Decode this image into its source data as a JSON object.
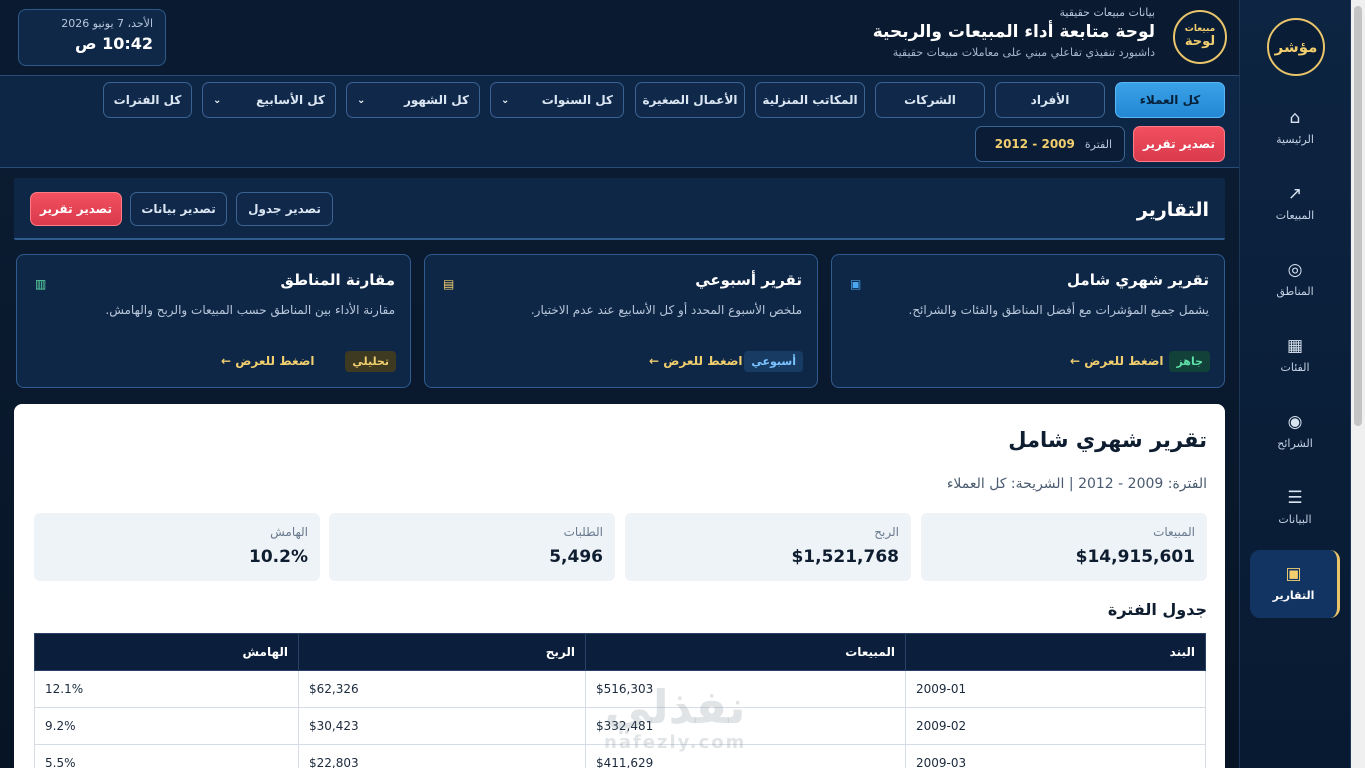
{
  "sidebar": {
    "logo": "مؤشر",
    "items": [
      {
        "label": "الرئيسية",
        "icon": "⌂"
      },
      {
        "label": "المبيعات",
        "icon": "↗"
      },
      {
        "label": "المناطق",
        "icon": "◎"
      },
      {
        "label": "الفئات",
        "icon": "▦"
      },
      {
        "label": "الشرائح",
        "icon": "◉"
      },
      {
        "label": "البيانات",
        "icon": "☰"
      },
      {
        "label": "التقارير",
        "icon": "▣"
      }
    ]
  },
  "header": {
    "badge_top": "مبيعات",
    "badge_bottom": "لوحة",
    "small": "بيانات مبيعات حقيقية",
    "title": "لوحة متابعة أداء المبيعات والربحية",
    "subtitle": "داشبورد تنفيذي تفاعلي مبني على معاملات مبيعات حقيقية",
    "date": "الأحد، 7 يونيو 2026",
    "time": "10:42 ص"
  },
  "filters": {
    "segments": [
      "كل العملاء",
      "الأفراد",
      "الشركات",
      "المكاتب المنزلية",
      "الأعمال الصغيرة"
    ],
    "selects": [
      "كل السنوات",
      "كل الشهور",
      "كل الأسابيع"
    ],
    "periods_btn": "كل الفترات",
    "export": "تصدير تقرير",
    "period_label": "الفترة",
    "period_value": "2009 - 2012",
    "chevron": "⌄"
  },
  "reports": {
    "title": "التقارير",
    "export_table": "تصدير جدول",
    "export_data": "تصدير بيانات",
    "export_report": "تصدير تقرير",
    "cards": [
      {
        "title": "تقرير شهري شامل",
        "desc": "يشمل جميع المؤشرات مع أفضل المناطق والفئات والشرائح.",
        "tag": "جاهز",
        "go": "اضغط للعرض ←",
        "icon": "▣"
      },
      {
        "title": "تقرير أسبوعي",
        "desc": "ملخص الأسبوع المحدد أو كل الأسابيع عند عدم الاختيار.",
        "tag": "أسبوعي",
        "go": "اضغط للعرض ←",
        "icon": "▤"
      },
      {
        "title": "مقارنة المناطق",
        "desc": "مقارنة الأداء بين المناطق حسب المبيعات والربح والهامش.",
        "tag": "تحليلي",
        "go": "اضغط للعرض ←",
        "icon": "▥"
      }
    ]
  },
  "report": {
    "title": "تقرير شهري شامل",
    "subtitle": "الفترة: 2009 - 2012 | الشريحة: كل العملاء",
    "kpis": [
      {
        "label": "المبيعات",
        "value": "$14,915,601"
      },
      {
        "label": "الربح",
        "value": "$1,521,768"
      },
      {
        "label": "الطلبات",
        "value": "5,496"
      },
      {
        "label": "الهامش",
        "value": "10.2%"
      }
    ],
    "table_title": "جدول الفترة",
    "columns": [
      "البند",
      "المبيعات",
      "الربح",
      "الهامش"
    ],
    "rows": [
      [
        "2009-01",
        "$516,303",
        "$62,326",
        "12.1%"
      ],
      [
        "2009-02",
        "$332,481",
        "$30,423",
        "9.2%"
      ],
      [
        "2009-03",
        "$411,629",
        "$22,803",
        "5.5%"
      ]
    ]
  },
  "watermark": {
    "ar": "نفذلي",
    "en": "nafezly.com"
  },
  "colors": {
    "accent_gold": "#e9c46a",
    "accent_blue": "#2387d3",
    "danger": "#d93a4c",
    "navy": "#0b1f3d"
  }
}
